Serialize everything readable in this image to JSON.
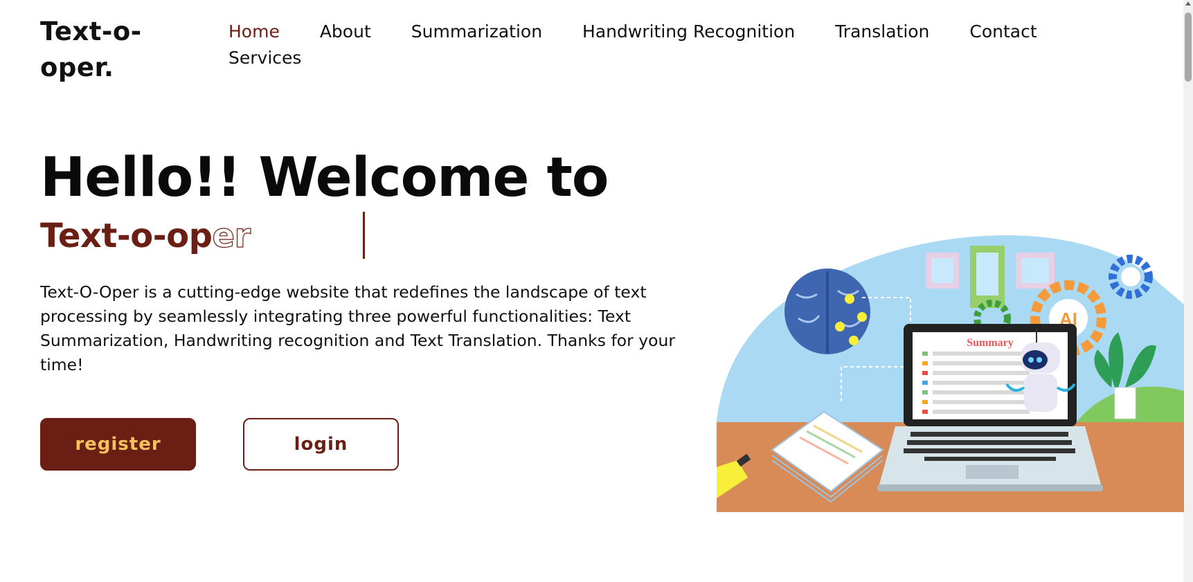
{
  "header": {
    "logo": "Text-o-oper.",
    "nav": [
      {
        "label": "Home",
        "active": true
      },
      {
        "label": "About",
        "active": false
      },
      {
        "label": "Summarization",
        "active": false
      },
      {
        "label": "Handwriting Recognition",
        "active": false
      },
      {
        "label": "Translation",
        "active": false
      },
      {
        "label": "Contact",
        "active": false
      },
      {
        "label": "Services",
        "active": false
      }
    ]
  },
  "hero": {
    "title": "Hello!! Welcome to",
    "typed_solid": "Text-o-op",
    "typed_outline": "er",
    "description": "Text-O-Oper is a cutting-edge website that redefines the landscape of text processing by seamlessly integrating three powerful functionalities: Text Summarization, Handwriting recognition and Text Translation. Thanks for your time!",
    "register_label": "register",
    "login_label": "login"
  },
  "illustration": {
    "laptop_screen_title": "Summary",
    "ai_badge": "AI"
  },
  "colors": {
    "brand": "#6b1f14",
    "accent": "#f4c15d"
  }
}
